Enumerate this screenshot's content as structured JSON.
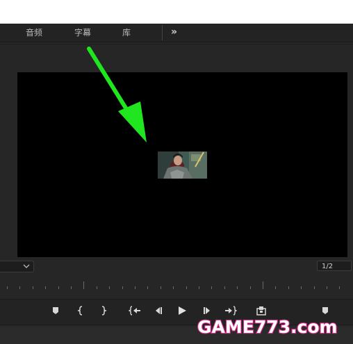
{
  "tabs": [
    {
      "label": "音频"
    },
    {
      "label": "字幕"
    },
    {
      "label": "库"
    }
  ],
  "overflow": {
    "glyph": "»"
  },
  "viewer": {
    "background": "#000000"
  },
  "zoom": {
    "value": ""
  },
  "page_counter": {
    "text": "1/2"
  },
  "transport": {
    "buttons": [
      "add-marker-icon",
      "mark-in-icon",
      "mark-out-icon",
      "go-to-in-icon",
      "step-back-icon",
      "play-icon",
      "step-forward-icon",
      "go-to-out-icon",
      "export-frame-icon",
      "marker-icon"
    ]
  },
  "annotation": {
    "color": "#1fe61f"
  },
  "watermark": {
    "text": "GAME773.com"
  }
}
